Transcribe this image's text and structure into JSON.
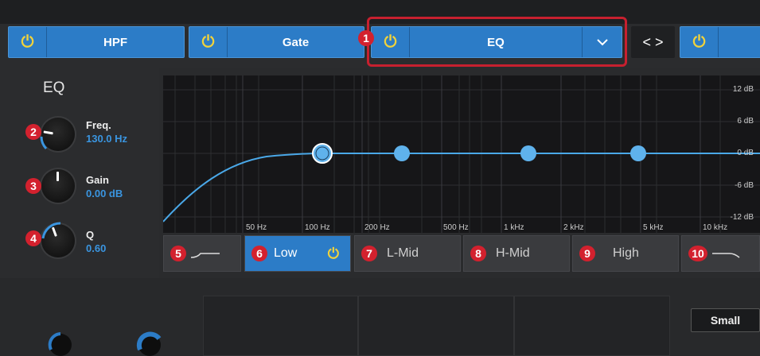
{
  "tabs": [
    {
      "label": "HPF"
    },
    {
      "label": "Gate"
    },
    {
      "label": "EQ"
    }
  ],
  "nav_label": "< >",
  "eq_title": "EQ",
  "knobs": [
    {
      "label": "Freq.",
      "value": "130.0 Hz",
      "badge": "2"
    },
    {
      "label": "Gain",
      "value": "0.00 dB",
      "badge": "3"
    },
    {
      "label": "Q",
      "value": "0.60",
      "badge": "4"
    }
  ],
  "badges": {
    "eq": "1",
    "hpf_band": "5",
    "low": "6",
    "lmid": "7",
    "hmid": "8",
    "high": "9",
    "lpf_band": "10"
  },
  "graph": {
    "db_labels": [
      "12 dB",
      "6 dB",
      "0 dB",
      "-6 dB",
      "-12 dB"
    ],
    "freq_labels": [
      "50 Hz",
      "100 Hz",
      "200 Hz",
      "500 Hz",
      "1 kHz",
      "2 kHz",
      "5 kHz",
      "10 kHz"
    ]
  },
  "bands": {
    "low": "Low",
    "lmid": "L-Mid",
    "hmid": "H-Mid",
    "high": "High"
  },
  "bottom": {
    "small_label": "Small"
  },
  "colors": {
    "accent": "#2c7cc7",
    "power": "#f0d23c",
    "badge": "#d3212e",
    "curve": "#4aa8e8"
  }
}
